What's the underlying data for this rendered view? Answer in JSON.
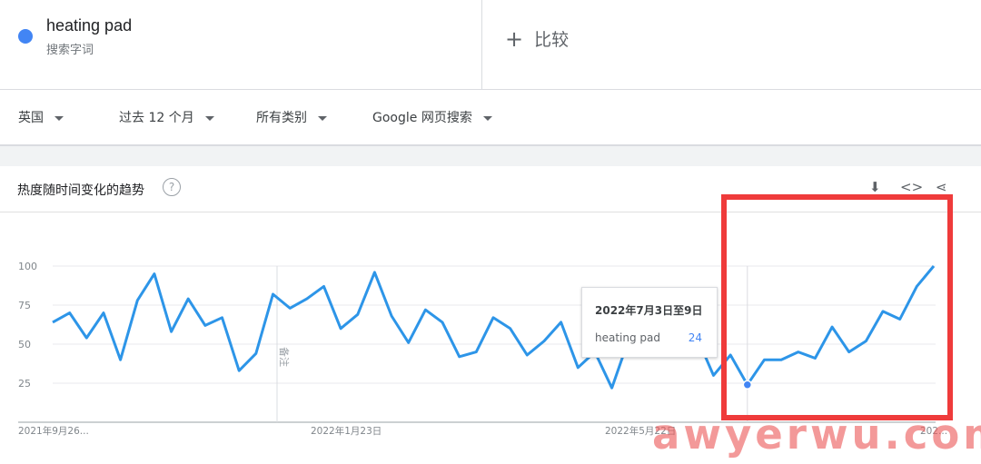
{
  "term": {
    "name": "heating pad",
    "subtitle": "搜索字词",
    "color": "#4285f4"
  },
  "compare": {
    "icon": "plus-icon",
    "label": "比较"
  },
  "filters": [
    {
      "label": "英国"
    },
    {
      "label": "过去 12 个月"
    },
    {
      "label": "所有类别"
    },
    {
      "label": "Google 网页搜索"
    }
  ],
  "panel": {
    "title": "热度随时间变化的趋势",
    "help_icon": "question-mark-icon",
    "download_icon": "download-icon",
    "embed_icon": "embed-code-icon",
    "share_icon": "share-icon"
  },
  "annotation": {
    "label": "备注"
  },
  "tooltip": {
    "date": "2022年7月3日至9日",
    "term": "heating pad",
    "value": "24"
  },
  "watermark": "awyerwu.com",
  "chart_data": {
    "type": "line",
    "x_tick_labels": [
      "2021年9月26...",
      "2022年1月23日",
      "2022年5月22日",
      "202..."
    ],
    "y_tick_labels": [
      "100",
      "75",
      "50",
      "25"
    ],
    "ylim": [
      0,
      100
    ],
    "grid": true,
    "series": [
      {
        "name": "heating pad",
        "color": "#2d95e8",
        "values": [
          64,
          70,
          54,
          70,
          40,
          78,
          95,
          58,
          79,
          62,
          67,
          33,
          44,
          82,
          73,
          79,
          87,
          60,
          69,
          96,
          68,
          51,
          72,
          64,
          42,
          45,
          67,
          60,
          43,
          52,
          64,
          35,
          45,
          22,
          53,
          56,
          62,
          46,
          55,
          30,
          43,
          24,
          40,
          40,
          45,
          41,
          61,
          45,
          52,
          71,
          66,
          87,
          100
        ]
      }
    ],
    "highlight_index": 41
  }
}
